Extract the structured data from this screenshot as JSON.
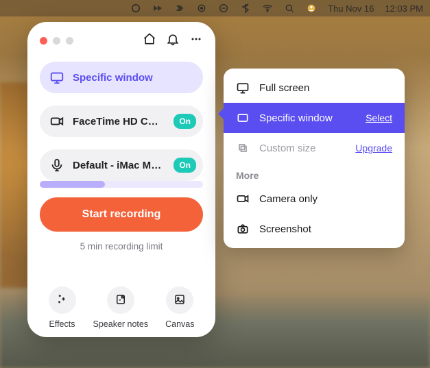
{
  "menubar": {
    "date": "Thu Nov 16",
    "time": "12:03 PM"
  },
  "panel": {
    "source": {
      "label": "Specific window"
    },
    "camera": {
      "label": "FaceTime HD Ca...",
      "badge": "On"
    },
    "mic": {
      "label": "Default - iMac Mi...",
      "badge": "On"
    },
    "start": "Start recording",
    "limit": "5 min recording limit",
    "bottom": {
      "effects": "Effects",
      "notes": "Speaker notes",
      "canvas": "Canvas"
    }
  },
  "popover": {
    "fullscreen": "Full screen",
    "specific": {
      "label": "Specific window",
      "action": "Select"
    },
    "custom": {
      "label": "Custom size",
      "action": "Upgrade"
    },
    "more": "More",
    "camera_only": "Camera only",
    "screenshot": "Screenshot"
  }
}
